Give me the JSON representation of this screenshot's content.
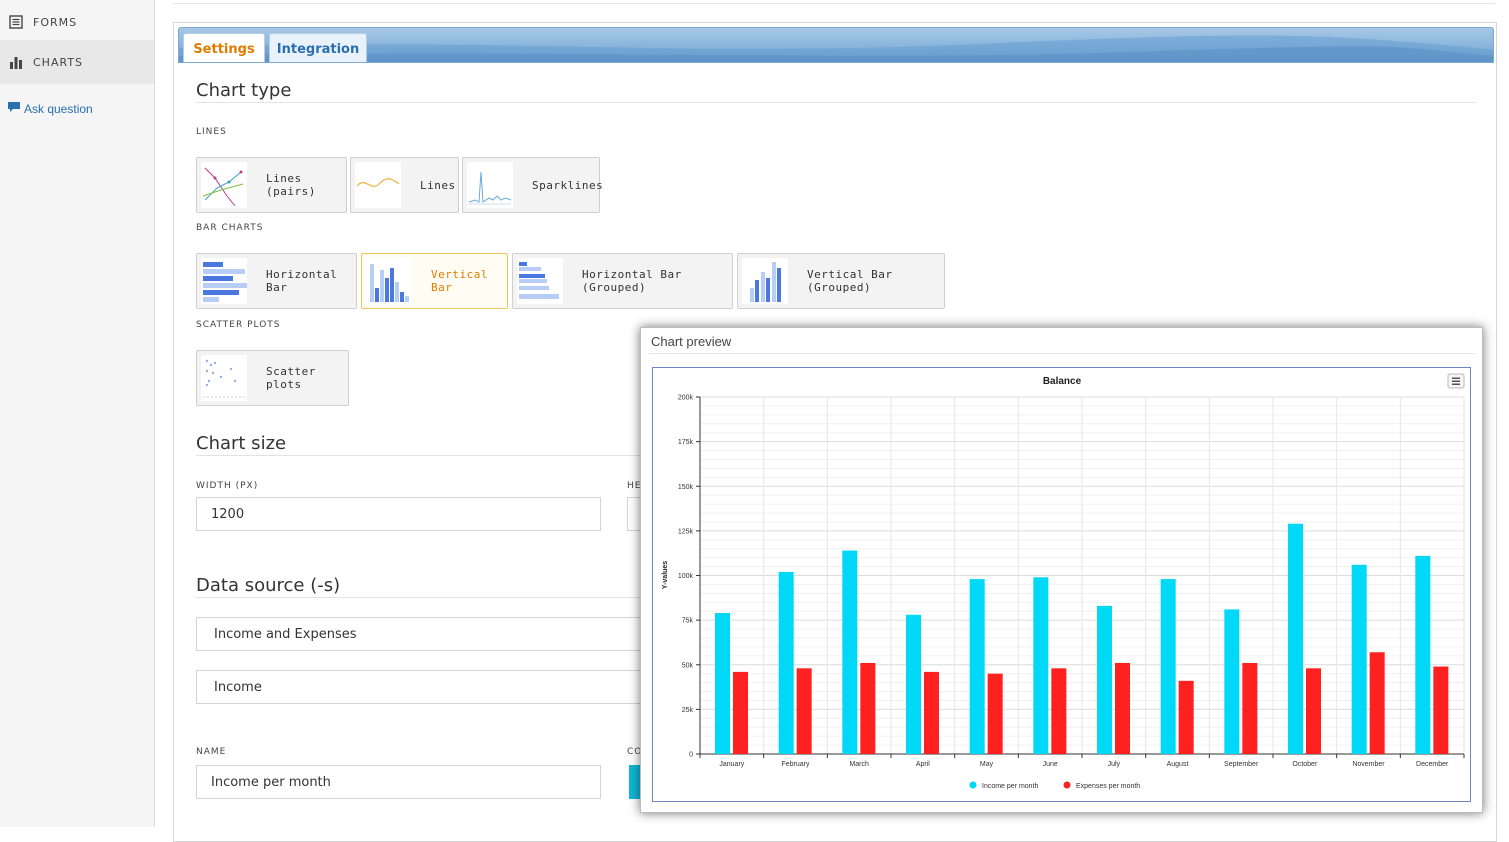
{
  "sidebar": {
    "items": [
      {
        "label": "FORMS",
        "icon": "list-icon"
      },
      {
        "label": "CHARTS",
        "icon": "bar-chart-icon"
      }
    ],
    "ask": {
      "label": "Ask question",
      "icon": "chat-bubble-icon"
    }
  },
  "tabs": [
    {
      "label": "Settings"
    },
    {
      "label": "Integration"
    }
  ],
  "chart_type": {
    "title": "Chart type",
    "categories": {
      "lines": "LINES",
      "bars": "BAR CHARTS",
      "scatter": "SCATTER PLOTS"
    },
    "options": {
      "lines_pairs": "Lines (pairs)",
      "lines": "Lines",
      "sparklines": "Sparklines",
      "horizontal_bar": "Horizontal Bar",
      "vertical_bar": "Vertical Bar",
      "horizontal_bar_grouped": "Horizontal Bar (Grouped)",
      "vertical_bar_grouped": "Vertical Bar (Grouped)",
      "scatter_plots": "Scatter plots"
    },
    "selected": "Vertical Bar"
  },
  "chart_size": {
    "title": "Chart size",
    "width_label": "WIDTH (PX)",
    "width_value": "1200",
    "height_label_partial": "HE"
  },
  "data_source": {
    "title": "Data source (-s)",
    "source_1": "Income and Expenses",
    "source_2": "Income",
    "name_label": "NAME",
    "name_value": "Income per month",
    "color_label_partial": "CO"
  },
  "preview": {
    "title": "Chart preview"
  },
  "chart_data": {
    "type": "bar",
    "title": "Balance",
    "ylabel": "Y-values",
    "xlabel": "",
    "categories": [
      "January",
      "February",
      "March",
      "April",
      "May",
      "June",
      "July",
      "August",
      "September",
      "October",
      "November",
      "December"
    ],
    "series": [
      {
        "name": "Income per month",
        "color": "#00d8f8",
        "values": [
          79000,
          102000,
          114000,
          78000,
          98000,
          99000,
          83000,
          98000,
          81000,
          129000,
          106000,
          111000
        ]
      },
      {
        "name": "Expenses per month",
        "color": "#ff2020",
        "values": [
          46000,
          48000,
          51000,
          46000,
          45000,
          48000,
          51000,
          41000,
          51000,
          48000,
          57000,
          49000
        ]
      }
    ],
    "ylim": [
      0,
      200000
    ],
    "yticks": [
      "0",
      "25k",
      "50k",
      "75k",
      "100k",
      "125k",
      "150k",
      "175k",
      "200k"
    ],
    "grid": true,
    "legend": "bottom"
  }
}
